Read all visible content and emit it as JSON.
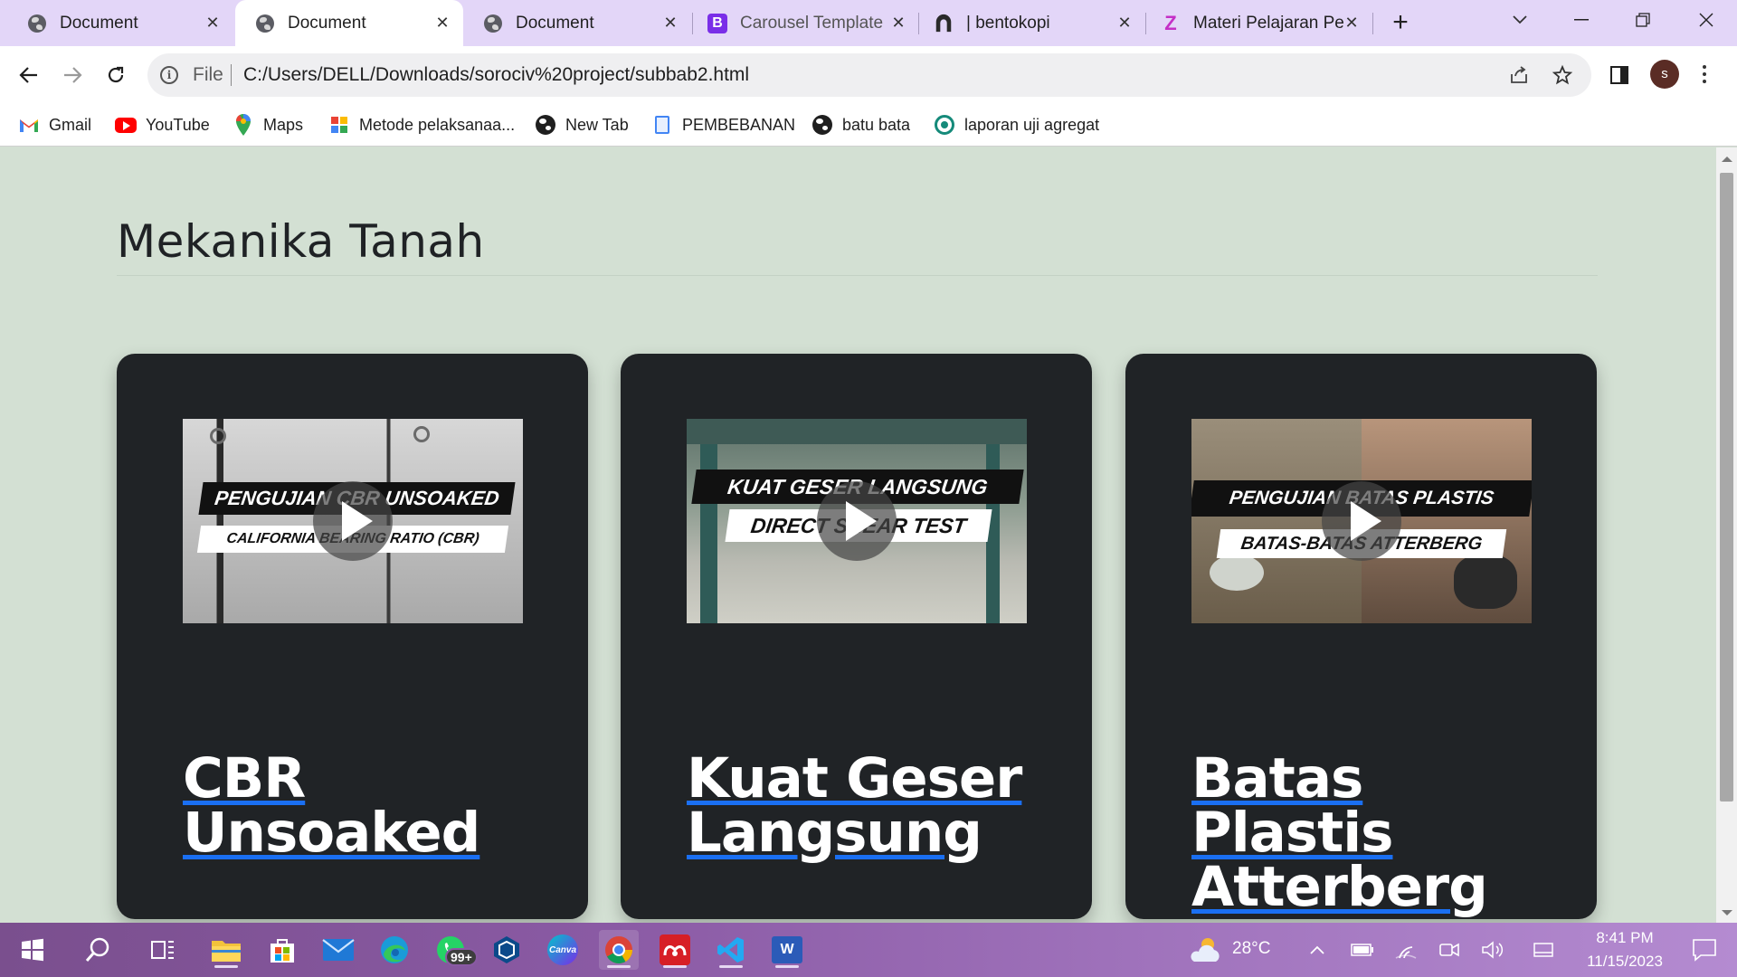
{
  "browser": {
    "tabs": [
      {
        "title": "Document",
        "icon": "globe-icon",
        "active": false
      },
      {
        "title": "Document",
        "icon": "globe-icon",
        "active": true
      },
      {
        "title": "Document",
        "icon": "globe-icon",
        "active": false
      },
      {
        "title": "Carousel Template",
        "icon": "bootstrap-icon",
        "active": false
      },
      {
        "title": "| bentokopi",
        "icon": "bentokopi-icon",
        "active": false
      },
      {
        "title": "Materi Pelajaran Pe",
        "icon": "z-icon",
        "active": false
      }
    ],
    "close_glyph": "✕",
    "new_tab_glyph": "+",
    "omnibox": {
      "scheme": "File",
      "url": "C:/Users/DELL/Downloads/sorociv%20project/subbab2.html"
    },
    "profile_initial": "s",
    "bookmarks": [
      {
        "label": "Gmail",
        "icon": "gmail-icon"
      },
      {
        "label": "YouTube",
        "icon": "youtube-icon"
      },
      {
        "label": "Maps",
        "icon": "maps-icon"
      },
      {
        "label": "Metode pelaksanaa...",
        "icon": "slides-icon"
      },
      {
        "label": "New Tab",
        "icon": "globe-icon"
      },
      {
        "label": "PEMBEBANAN",
        "icon": "document-icon"
      },
      {
        "label": "batu bata",
        "icon": "globe-icon"
      },
      {
        "label": "laporan uji agregat",
        "icon": "site-icon"
      }
    ]
  },
  "page": {
    "title": "Mekanika Tanah",
    "cards": [
      {
        "title_line1": "CBR",
        "title_line2": "Unsoaked",
        "thumb_banner1": "PENGUJIAN CBR UNSOAKED",
        "thumb_banner2": "CALIFORNIA BEARING RATIO (CBR)"
      },
      {
        "title_line1": "Kuat Geser",
        "title_line2": "Langsung",
        "thumb_banner1": "KUAT GESER LANGSUNG",
        "thumb_banner2": "DIRECT SHEAR TEST"
      },
      {
        "title_line1": "Batas Plastis",
        "title_line2": "Atterberg",
        "thumb_banner1": "PENGUJIAN BATAS PLASTIS",
        "thumb_banner2": "BATAS-BATAS ATTERBERG"
      }
    ],
    "accent_color": "#1a6ff2",
    "background_color": "#d3e0d3",
    "card_color": "#202326"
  },
  "taskbar": {
    "whatsapp_badge": "99+",
    "canva_label": "Canva",
    "weather": "28°C",
    "time": "8:41 PM",
    "date": "11/15/2023"
  }
}
